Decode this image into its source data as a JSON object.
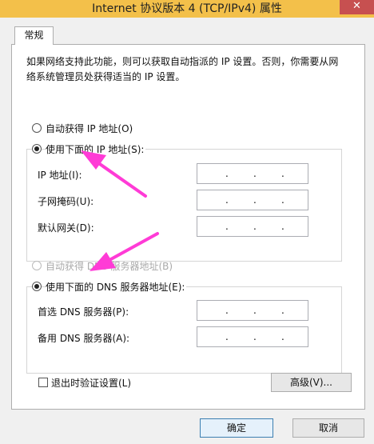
{
  "window": {
    "title": "Internet 协议版本 4 (TCP/IPv4) 属性",
    "close_glyph": "✕"
  },
  "tabs": [
    {
      "label": "常规"
    }
  ],
  "description": "如果网络支持此功能，则可以获取自动指派的 IP 设置。否则，你需要从网络系统管理员处获得适当的 IP 设置。",
  "ip": {
    "auto_label": "自动获得 IP 地址(O)",
    "manual_label": "使用下面的 IP 地址(S):",
    "selected": "manual",
    "fields": [
      {
        "label": "IP 地址(I):",
        "value": ". . ."
      },
      {
        "label": "子网掩码(U):",
        "value": ". . ."
      },
      {
        "label": "默认网关(D):",
        "value": ". . ."
      }
    ]
  },
  "dns": {
    "auto_label": "自动获得 DNS 服务器地址(B)",
    "manual_label": "使用下面的 DNS 服务器地址(E):",
    "selected": "manual",
    "fields": [
      {
        "label": "首选 DNS 服务器(P):",
        "value": ". . ."
      },
      {
        "label": "备用 DNS 服务器(A):",
        "value": ". . ."
      }
    ]
  },
  "validate_label": "退出时验证设置(L)",
  "advanced_label": "高级(V)...",
  "ok_label": "确定",
  "cancel_label": "取消",
  "colors": {
    "titlebar": "#f3c04a",
    "close": "#c75050",
    "annotation_arrow": "#ff3bd6"
  }
}
